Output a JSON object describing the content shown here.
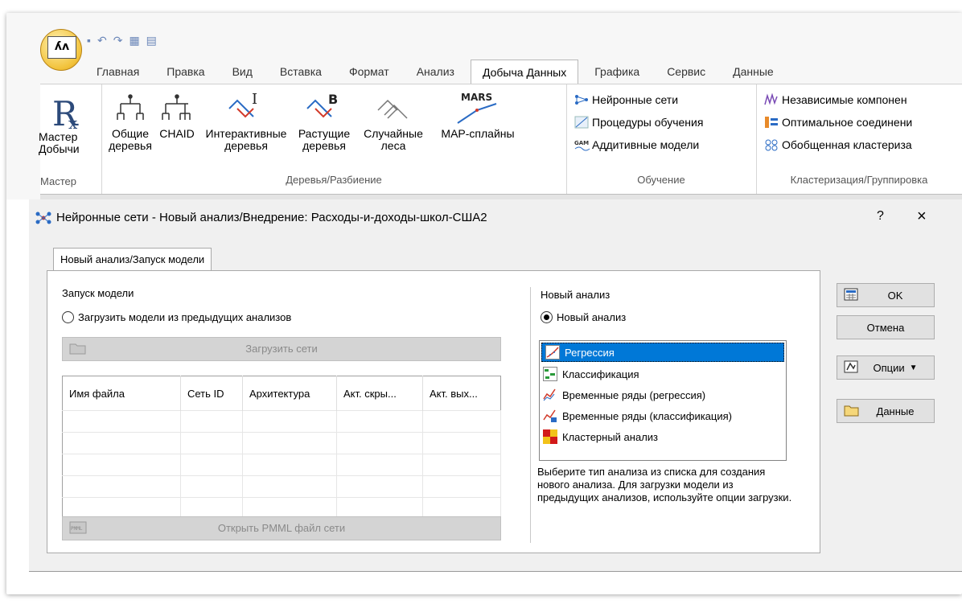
{
  "ribbon": {
    "tabs": [
      "Главная",
      "Правка",
      "Вид",
      "Вставка",
      "Формат",
      "Анализ",
      "Добыча Данных",
      "Графика",
      "Сервис",
      "Данные"
    ],
    "active_tab_index": 6,
    "wizard": {
      "label_line1": "Мастер",
      "label_line2": "Добычи",
      "group_label": "Мастер"
    },
    "trees_group": {
      "label": "Деревья/Разбиение",
      "buttons": [
        {
          "line1": "Общие",
          "line2": "деревья"
        },
        {
          "line1": "CHAID",
          "line2": ""
        },
        {
          "line1": "Интерактивные",
          "line2": "деревья"
        },
        {
          "line1": "Растущие",
          "line2": "деревья"
        },
        {
          "line1": "Случайные",
          "line2": "леса"
        },
        {
          "line1": "MAP-сплайны",
          "line2": ""
        }
      ],
      "mars_text": "MARS",
      "interactive_mark": "I",
      "boosting_mark": "B"
    },
    "learning_group": {
      "label": "Обучение",
      "items": [
        "Нейронные сети",
        "Процедуры обучения",
        "Аддитивные модели"
      ],
      "gam_text": "GAM"
    },
    "clustering_group": {
      "label": "Кластеризация/Группировка",
      "items": [
        "Независимые компонен",
        "Оптимальное соединени",
        "Обобщенная кластериза"
      ]
    }
  },
  "dialog": {
    "title": "Нейронные сети - Новый анализ/Внедрение: Расходы-и-доходы-школ-США2",
    "help": "?",
    "close": "×",
    "tab_label": "Новый анализ/Запуск модели",
    "model_launch": {
      "group_label": "Запуск модели",
      "radio_label": "Загрузить модели из предыдущих анализов",
      "load_button": "Загрузить сети",
      "columns": [
        "Имя файла",
        "Сеть ID",
        "Архитектура",
        "Акт. скры...",
        "Акт. вых..."
      ],
      "pmml_button": "Открыть PMML файл сети",
      "pmml_icon_text": "PMML"
    },
    "new_analysis": {
      "group_label": "Новый анализ",
      "radio_label": "Новый анализ",
      "options": [
        "Регрессия",
        "Классификация",
        "Временные ряды (регрессия)",
        "Временные ряды (классификация)",
        "Кластерный анализ"
      ],
      "selected_index": 0,
      "hint": "Выберите тип анализа из списка для создания нового анализа. Для загрузки модели из предыдущих анализов, используйте опции загрузки."
    },
    "buttons": {
      "ok": "OK",
      "cancel": "Отмена",
      "options": "Опции",
      "data": "Данные"
    }
  },
  "colors": {
    "selection": "#0078d7",
    "accent_tab": "#ffffff",
    "ribbon_bg": "#f7f7f7"
  }
}
